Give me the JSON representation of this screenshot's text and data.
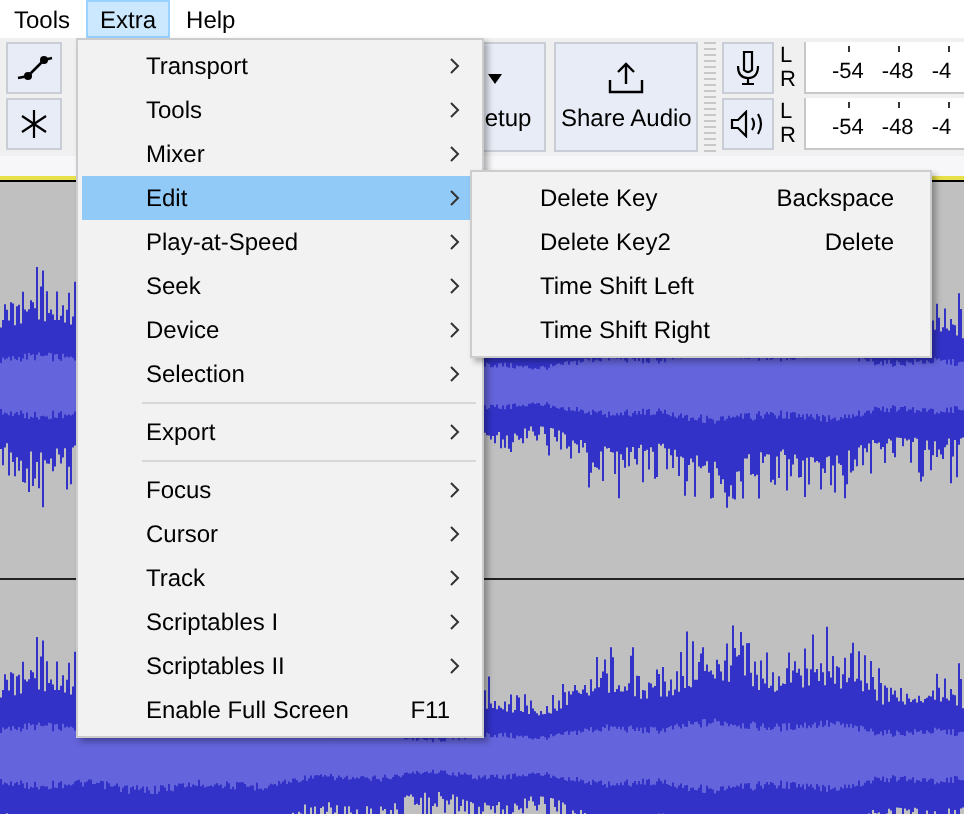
{
  "menu_bar": [
    {
      "label": "Tools",
      "selected": false
    },
    {
      "label": "Extra",
      "selected": true
    },
    {
      "label": "Help",
      "selected": false
    }
  ],
  "toolbar": {
    "partial_button_label": "etup",
    "share_button_label": "Share Audio",
    "meters": [
      {
        "kind": "record",
        "channels": [
          "L",
          "R"
        ],
        "ticks": [
          "-54",
          "-48",
          "-4"
        ]
      },
      {
        "kind": "playback",
        "channels": [
          "L",
          "R"
        ],
        "ticks": [
          "-54",
          "-48",
          "-4"
        ]
      }
    ]
  },
  "dropdown": {
    "items": [
      {
        "kind": "submenu",
        "label": "Transport",
        "selected": false
      },
      {
        "kind": "submenu",
        "label": "Tools",
        "selected": false
      },
      {
        "kind": "submenu",
        "label": "Mixer",
        "selected": false
      },
      {
        "kind": "submenu",
        "label": "Edit",
        "selected": true
      },
      {
        "kind": "submenu",
        "label": "Play-at-Speed",
        "selected": false
      },
      {
        "kind": "submenu",
        "label": "Seek",
        "selected": false
      },
      {
        "kind": "submenu",
        "label": "Device",
        "selected": false
      },
      {
        "kind": "submenu",
        "label": "Selection",
        "selected": false
      },
      {
        "kind": "separator"
      },
      {
        "kind": "submenu",
        "label": "Export",
        "selected": false
      },
      {
        "kind": "separator"
      },
      {
        "kind": "submenu",
        "label": "Focus",
        "selected": false
      },
      {
        "kind": "submenu",
        "label": "Cursor",
        "selected": false
      },
      {
        "kind": "submenu",
        "label": "Track",
        "selected": false
      },
      {
        "kind": "submenu",
        "label": "Scriptables I",
        "selected": false
      },
      {
        "kind": "submenu",
        "label": "Scriptables II",
        "selected": false
      },
      {
        "kind": "command",
        "label": "Enable Full Screen",
        "shortcut": "F11",
        "selected": false
      }
    ]
  },
  "submenu": {
    "items": [
      {
        "label": "Delete Key",
        "shortcut": "Backspace"
      },
      {
        "label": "Delete Key2",
        "shortcut": "Delete"
      },
      {
        "label": "Time Shift Left"
      },
      {
        "label": "Time Shift Right"
      }
    ]
  }
}
